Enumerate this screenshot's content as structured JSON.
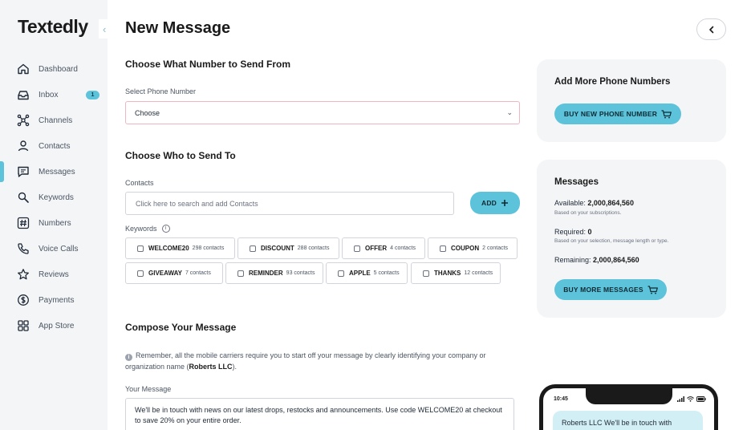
{
  "app": {
    "logo": "Textedly"
  },
  "sidebar": {
    "items": [
      {
        "label": "Dashboard",
        "icon": "home-icon"
      },
      {
        "label": "Inbox",
        "icon": "inbox-icon",
        "badge": "1"
      },
      {
        "label": "Channels",
        "icon": "channels-icon"
      },
      {
        "label": "Contacts",
        "icon": "user-icon"
      },
      {
        "label": "Messages",
        "icon": "message-icon",
        "active": true
      },
      {
        "label": "Keywords",
        "icon": "keyword-icon"
      },
      {
        "label": "Numbers",
        "icon": "hash-icon"
      },
      {
        "label": "Voice Calls",
        "icon": "phone-icon"
      },
      {
        "label": "Reviews",
        "icon": "star-icon"
      },
      {
        "label": "Payments",
        "icon": "dollar-icon"
      },
      {
        "label": "App Store",
        "icon": "grid-icon"
      }
    ]
  },
  "main": {
    "title": "New Message",
    "from_section": {
      "title": "Choose What Number to Send From",
      "select_label": "Select Phone Number",
      "select_value": "Choose"
    },
    "to_section": {
      "title": "Choose Who to Send To",
      "contacts_label": "Contacts",
      "contacts_placeholder": "Click here to search and add Contacts",
      "add_label": "ADD",
      "keywords_label": "Keywords",
      "keywords": [
        {
          "name": "WELCOME20",
          "count": "298 contacts"
        },
        {
          "name": "DISCOUNT",
          "count": "288 contacts"
        },
        {
          "name": "OFFER",
          "count": "4 contacts"
        },
        {
          "name": "COUPON",
          "count": "2 contacts"
        },
        {
          "name": "GIVEAWAY",
          "count": "7 contacts"
        },
        {
          "name": "REMINDER",
          "count": "93 contacts"
        },
        {
          "name": "APPLE",
          "count": "5 contacts"
        },
        {
          "name": "THANKS",
          "count": "12 contacts"
        }
      ]
    },
    "compose_section": {
      "title": "Compose Your Message",
      "notice_pre": "Remember, all the mobile carriers require you to start off your message by clearly identifying your company or organization name (",
      "notice_company": "Roberts LLC",
      "notice_post": ").",
      "message_label": "Your Message",
      "message_text": "We'll be in touch with news on our latest drops, restocks and announcements. Use code WELCOME20 at checkout to save 20% on your entire order."
    }
  },
  "right": {
    "phone_card": {
      "title": "Add More Phone Numbers",
      "button": "BUY NEW PHONE NUMBER"
    },
    "messages_card": {
      "title": "Messages",
      "available_label": "Available:",
      "available_value": "2,000,864,560",
      "available_sub": "Based on your subscriptions.",
      "required_label": "Required:",
      "required_value": "0",
      "required_sub": "Based on your selection, message length or type.",
      "remaining_label": "Remaining:",
      "remaining_value": "2,000,864,560",
      "button": "BUY MORE MESSAGES"
    },
    "preview": {
      "time": "10:45",
      "bubble_text": "Roberts LLC We'll be in touch with"
    }
  },
  "colors": {
    "accent": "#5cc3da",
    "sidebar_bg": "#f4f5f7",
    "card_bg": "#f4f5f7"
  }
}
